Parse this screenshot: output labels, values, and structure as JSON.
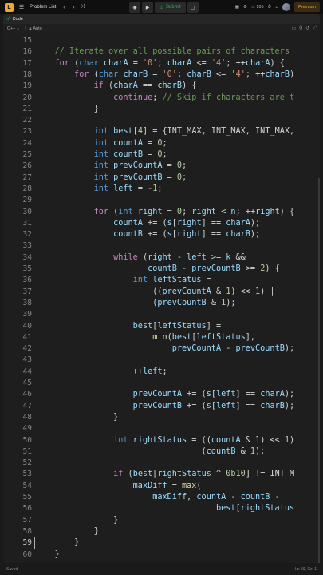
{
  "topbar": {
    "logo_char": "L",
    "problem_list_label": "Problem List",
    "submit_label": "Submit",
    "streak_count": "105",
    "premium_label": "Premium"
  },
  "panel": {
    "tab_label": "Code",
    "language": "C++",
    "mode": "Auto"
  },
  "editor": {
    "lines": [
      {
        "n": "15",
        "html": ""
      },
      {
        "n": "16",
        "html": "    <span class=\"com\">// Iterate over all possible pairs of characters</span>"
      },
      {
        "n": "17",
        "html": "    <span class=\"ctl\">for</span> (<span class=\"kw\">char</span> <span class=\"var\">charA</span> = <span class=\"str\">'0'</span>; <span class=\"var\">charA</span> &lt;= <span class=\"str\">'4'</span>; ++<span class=\"var\">charA</span>) {"
      },
      {
        "n": "18",
        "html": "        <span class=\"ctl\">for</span> (<span class=\"kw\">char</span> <span class=\"var\">charB</span> = <span class=\"str\">'0'</span>; <span class=\"var\">charB</span> &lt;= <span class=\"str\">'4'</span>; ++<span class=\"var\">charB</span>)"
      },
      {
        "n": "19",
        "html": "            <span class=\"ctl\">if</span> (<span class=\"var\">charA</span> == <span class=\"var\">charB</span>) {"
      },
      {
        "n": "20",
        "html": "                <span class=\"ctl\">continue</span>; <span class=\"com\">// Skip if characters are t</span>"
      },
      {
        "n": "21",
        "html": "            }"
      },
      {
        "n": "22",
        "html": ""
      },
      {
        "n": "23",
        "html": "            <span class=\"kw\">int</span> <span class=\"var\">best</span>[<span class=\"num\">4</span>] = {INT_MAX, INT_MAX, INT_MAX,"
      },
      {
        "n": "24",
        "html": "            <span class=\"kw\">int</span> <span class=\"var\">countA</span> = <span class=\"num\">0</span>;"
      },
      {
        "n": "25",
        "html": "            <span class=\"kw\">int</span> <span class=\"var\">countB</span> = <span class=\"num\">0</span>;"
      },
      {
        "n": "26",
        "html": "            <span class=\"kw\">int</span> <span class=\"var\">prevCountA</span> = <span class=\"num\">0</span>;"
      },
      {
        "n": "27",
        "html": "            <span class=\"kw\">int</span> <span class=\"var\">prevCountB</span> = <span class=\"num\">0</span>;"
      },
      {
        "n": "28",
        "html": "            <span class=\"kw\">int</span> <span class=\"var\">left</span> = -<span class=\"num\">1</span>;"
      },
      {
        "n": "29",
        "html": ""
      },
      {
        "n": "30",
        "html": "            <span class=\"ctl\">for</span> (<span class=\"kw\">int</span> <span class=\"var\">right</span> = <span class=\"num\">0</span>; <span class=\"var\">right</span> &lt; <span class=\"var\">n</span>; ++<span class=\"var\">right</span>) {"
      },
      {
        "n": "31",
        "html": "                <span class=\"var\">countA</span> += (<span class=\"var\">s</span>[<span class=\"var\">right</span>] == <span class=\"var\">charA</span>);"
      },
      {
        "n": "32",
        "html": "                <span class=\"var\">countB</span> += (<span class=\"var\">s</span>[<span class=\"var\">right</span>] == <span class=\"var\">charB</span>);"
      },
      {
        "n": "33",
        "html": ""
      },
      {
        "n": "34",
        "html": "                <span class=\"ctl\">while</span> (<span class=\"var\">right</span> - <span class=\"var\">left</span> &gt;= <span class=\"var\">k</span> &amp;&amp;"
      },
      {
        "n": "35",
        "html": "                       <span class=\"var\">countB</span> - <span class=\"var\">prevCountB</span> &gt;= <span class=\"num\">2</span>) {"
      },
      {
        "n": "36",
        "html": "                    <span class=\"kw\">int</span> <span class=\"var\">leftStatus</span> ="
      },
      {
        "n": "37",
        "html": "                        ((<span class=\"var\">prevCountA</span> &amp; <span class=\"num\">1</span>) &lt;&lt; <span class=\"num\">1</span>) |"
      },
      {
        "n": "38",
        "html": "                        (<span class=\"var\">prevCountB</span> &amp; <span class=\"num\">1</span>);"
      },
      {
        "n": "39",
        "html": ""
      },
      {
        "n": "40",
        "html": "                    <span class=\"var\">best</span>[<span class=\"var\">leftStatus</span>] ="
      },
      {
        "n": "41",
        "html": "                        <span class=\"fn\">min</span>(<span class=\"var\">best</span>[<span class=\"var\">leftStatus</span>],"
      },
      {
        "n": "42",
        "html": "                            <span class=\"var\">prevCountA</span> - <span class=\"var\">prevCountB</span>);"
      },
      {
        "n": "43",
        "html": ""
      },
      {
        "n": "44",
        "html": "                    ++<span class=\"var\">left</span>;"
      },
      {
        "n": "45",
        "html": ""
      },
      {
        "n": "46",
        "html": "                    <span class=\"var\">prevCountA</span> += (<span class=\"var\">s</span>[<span class=\"var\">left</span>] == <span class=\"var\">charA</span>);"
      },
      {
        "n": "47",
        "html": "                    <span class=\"var\">prevCountB</span> += (<span class=\"var\">s</span>[<span class=\"var\">left</span>] == <span class=\"var\">charB</span>);"
      },
      {
        "n": "48",
        "html": "                }"
      },
      {
        "n": "49",
        "html": ""
      },
      {
        "n": "50",
        "html": "                <span class=\"kw\">int</span> <span class=\"var\">rightStatus</span> = ((<span class=\"var\">countA</span> &amp; <span class=\"num\">1</span>) &lt;&lt; <span class=\"num\">1</span>)"
      },
      {
        "n": "51",
        "html": "                                  (<span class=\"var\">countB</span> &amp; <span class=\"num\">1</span>);"
      },
      {
        "n": "52",
        "html": ""
      },
      {
        "n": "53",
        "html": "                <span class=\"ctl\">if</span> (<span class=\"var\">best</span>[<span class=\"var\">rightStatus</span> ^ <span class=\"num\">0b10</span>] != INT_M"
      },
      {
        "n": "54",
        "html": "                    <span class=\"var\">maxDiff</span> = <span class=\"fn\">max</span>("
      },
      {
        "n": "55",
        "html": "                        <span class=\"var\">maxDiff</span>, <span class=\"var\">countA</span> - <span class=\"var\">countB</span> -"
      },
      {
        "n": "56",
        "html": "                                     <span class=\"var\">best</span>[<span class=\"var\">rightStatus</span>"
      },
      {
        "n": "57",
        "html": "                }"
      },
      {
        "n": "58",
        "html": "            }"
      },
      {
        "n": "59",
        "html": "        }"
      },
      {
        "n": "60",
        "html": "    }"
      }
    ],
    "active_line": "59"
  },
  "status": {
    "saved_label": "Saved",
    "cursor_position": "Ln 59, Col 1"
  },
  "colors": {
    "background": "#1e1e1e",
    "keyword": "#569cd6",
    "control": "#c586c0",
    "comment": "#6a9955",
    "string": "#ce9178",
    "number": "#b5cea8",
    "variable": "#9cdcfe",
    "accent_green": "#2cbb5d",
    "premium_orange": "#f0a52c"
  }
}
